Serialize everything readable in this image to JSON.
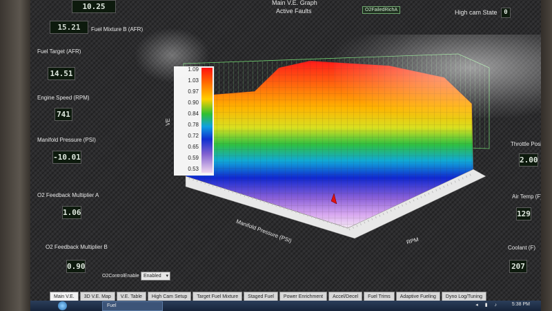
{
  "header": {
    "top_left_value": "10.25",
    "top_left_value2": "15.21",
    "graph_title": "Main V.E. Graph",
    "faults_label": "Active Faults",
    "fault_badge": "O2FailedRichA",
    "high_cam_label": "High cam State",
    "high_cam_value": "0"
  },
  "left_gauges": {
    "fuel_mixture_label": "Fuel Mixture B (AFR)",
    "fuel_target_label": "Fuel Target (AFR)",
    "fuel_target_value": "14.51",
    "engine_speed_label": "Engine Speed (RPM)",
    "engine_speed_value": "741",
    "map_label": "Manifold Pressure (PSI)",
    "map_value": "-10.01",
    "o2a_label": "O2 Feedback Multiplier A",
    "o2a_value": "1.06",
    "o2b_label": "O2 Feedback Multiplier B",
    "o2b_value": "0.90"
  },
  "right_gauges": {
    "throttle_label": "Throttle Position",
    "throttle_value": "2.00",
    "air_temp_label": "Air Temp (F)",
    "air_temp_value": "129",
    "coolant_label": "Coolant (F)",
    "coolant_value": "207"
  },
  "o2_control": {
    "label": "O2ControlEnable",
    "value": "Enabled"
  },
  "graph": {
    "ve_axis_label": "VE",
    "x_axis_label": "Manifold Pressure (PSI)",
    "y_axis_label": "RPM",
    "legend_ticks": [
      "1.09",
      "1.03",
      "0.97",
      "0.90",
      "0.84",
      "0.78",
      "0.72",
      "0.65",
      "0.59",
      "0.53"
    ]
  },
  "tabs": [
    "Main V.E.",
    "3D V.E. Map",
    "V.E. Table",
    "High Cam Setup",
    "Target Fuel Mixture",
    "Staged Fuel",
    "Power Enrichment",
    "Accel/Decel",
    "Fuel Trims",
    "Adaptive Fueling",
    "Dyno Log/Tuning"
  ],
  "taskbar": {
    "task_label": "Fuel",
    "clock": "5:38 PM"
  }
}
